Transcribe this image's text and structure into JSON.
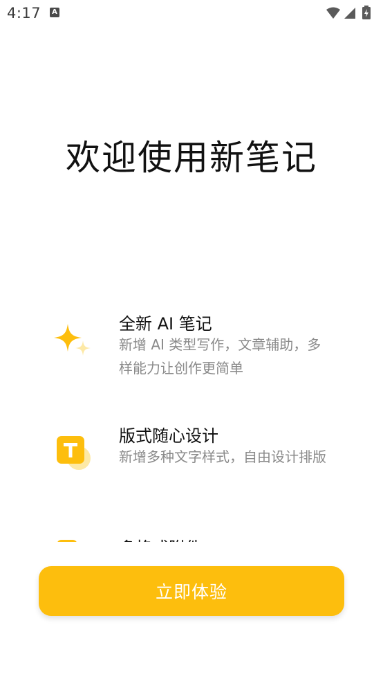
{
  "status_bar": {
    "time": "4:17",
    "notification_icon": "A",
    "icons": [
      "wifi-icon",
      "signal-icon",
      "battery-charging-icon"
    ]
  },
  "title": "欢迎使用新笔记",
  "features": [
    {
      "icon": "sparkle-icon",
      "title": "全新 AI 笔记",
      "desc": "新增 AI 类型写作，文章辅助，多样能力让创作更简单"
    },
    {
      "icon": "text-style-icon",
      "title": "版式随心设计",
      "desc": "新增多种文字样式，自由设计排版"
    },
    {
      "icon": "attachment-icon",
      "title": "多格式附件",
      "desc": ""
    }
  ],
  "cta": {
    "label": "立即体验"
  },
  "colors": {
    "accent": "#FDBE0D",
    "accent_light": "#FDE9A6",
    "title": "#111111",
    "desc": "#8A8A8A"
  }
}
